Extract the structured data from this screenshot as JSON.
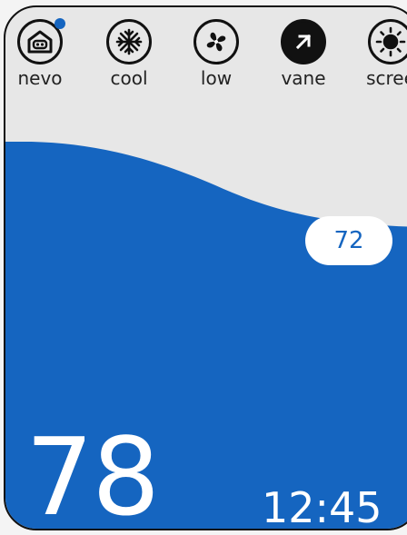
{
  "toolbar": {
    "items": [
      {
        "label": "nevo",
        "icon": "home-icon"
      },
      {
        "label": "cool",
        "icon": "snowflake-icon"
      },
      {
        "label": "low",
        "icon": "fan-icon"
      },
      {
        "label": "vane",
        "icon": "arrow-up-right-icon"
      },
      {
        "label": "scree",
        "icon": "sun-icon"
      }
    ]
  },
  "display": {
    "setpoint": "72",
    "current_temperature": "78",
    "time": "12:45"
  },
  "colors": {
    "accent": "#1565c0",
    "background": "#e7e7e7",
    "icon_dark": "#111111"
  }
}
